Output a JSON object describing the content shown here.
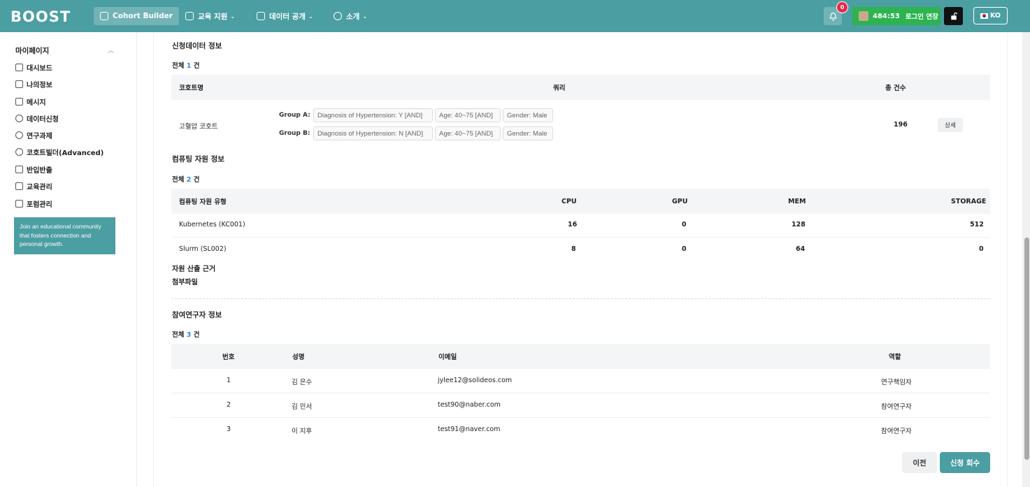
{
  "header": {
    "logo": "BOOST",
    "nav": [
      {
        "label": "Cohort Builder",
        "icon": "table-icon"
      },
      {
        "label": "교육 지원",
        "icon": "monitor-icon"
      },
      {
        "label": "데이터 공개",
        "icon": "document-icon"
      },
      {
        "label": "소개",
        "icon": "chart-icon"
      }
    ],
    "notification_count": "0",
    "timer": "484:53",
    "extend_label": "로그인 연장",
    "lang": "KO"
  },
  "sidebar": {
    "title": "마이페이지",
    "items": [
      {
        "label": "대시보드",
        "icon": "dashboard-icon"
      },
      {
        "label": "나의정보",
        "icon": "layers-icon"
      },
      {
        "label": "메시지",
        "icon": "message-icon"
      },
      {
        "label": "데이터신청",
        "icon": "data-icon"
      },
      {
        "label": "연구과제",
        "icon": "research-icon"
      },
      {
        "label": "코호트빌더(Advanced)",
        "icon": "chart-icon"
      },
      {
        "label": "반입반출",
        "icon": "layers-icon"
      },
      {
        "label": "교육관리",
        "icon": "layers-icon"
      },
      {
        "label": "포럼관리",
        "icon": "layers-icon"
      }
    ],
    "promo": "Join an educational community that fosters connection and personal growth."
  },
  "application_data": {
    "title": "신청데이터 정보",
    "total_prefix": "전체",
    "total": "1",
    "total_suffix": "건",
    "columns": [
      "코호트명",
      "쿼리",
      "총 건수"
    ],
    "row": {
      "name": "고혈압 코호트",
      "group_a_label": "Group A:",
      "group_a_tags": [
        "Diagnosis of Hypertension: Y [AND]",
        "Age: 40~75 [AND]",
        "Gender: Male"
      ],
      "group_b_label": "Group B:",
      "group_b_tags": [
        "Diagnosis of Hypertension: N [AND]",
        "Age: 40~75 [AND]",
        "Gender: Male"
      ],
      "count": "196",
      "detail_label": "상세"
    }
  },
  "computing": {
    "title": "컴퓨팅 자원 정보",
    "total_prefix": "전체",
    "total": "2",
    "total_suffix": "건",
    "columns": [
      "컴퓨팅 자원 유형",
      "CPU",
      "GPU",
      "MEM",
      "STORAGE"
    ],
    "rows": [
      {
        "type": "Kubernetes (KC001)",
        "cpu": "16",
        "gpu": "0",
        "mem": "128",
        "storage": "512"
      },
      {
        "type": "Slurm (SL002)",
        "cpu": "8",
        "gpu": "0",
        "mem": "64",
        "storage": "0"
      }
    ],
    "basis_label": "자원 산출 근거",
    "attachment_label": "첨부파일"
  },
  "researchers": {
    "title": "참여연구자 정보",
    "total_prefix": "전체",
    "total": "3",
    "total_suffix": "건",
    "columns": [
      "번호",
      "성명",
      "이메일",
      "역할"
    ],
    "rows": [
      {
        "no": "1",
        "name": "김 은수",
        "email": "jylee12@solideos.com",
        "role": "연구책임자"
      },
      {
        "no": "2",
        "name": "김 민서",
        "email": "test90@naber.com",
        "role": "참여연구자"
      },
      {
        "no": "3",
        "name": "이 지후",
        "email": "test91@naver.com",
        "role": "참여연구자"
      }
    ]
  },
  "actions": {
    "prev_label": "이전",
    "cancel_label": "신청 회수"
  }
}
